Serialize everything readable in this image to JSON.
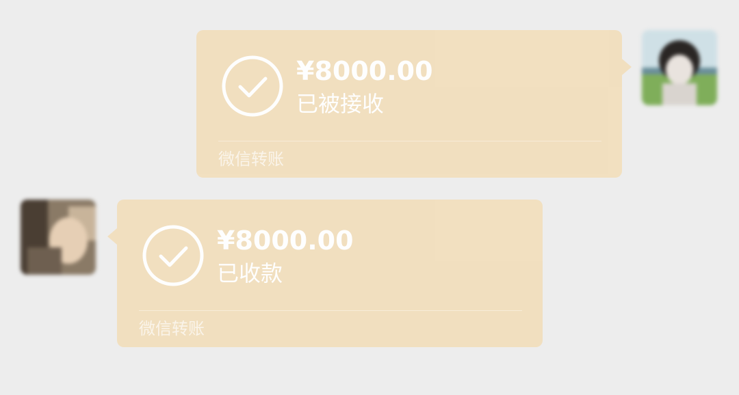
{
  "colors": {
    "background": "#ededed",
    "bubble": "#f2dfbe",
    "text": "#ffffff"
  },
  "messages": [
    {
      "side": "right",
      "amount": "¥8000.00",
      "status": "已被接收",
      "footer": "微信转账",
      "icon": "check-circle-icon"
    },
    {
      "side": "left",
      "amount": "¥8000.00",
      "status": "已收款",
      "footer": "微信转账",
      "icon": "check-circle-icon"
    }
  ]
}
